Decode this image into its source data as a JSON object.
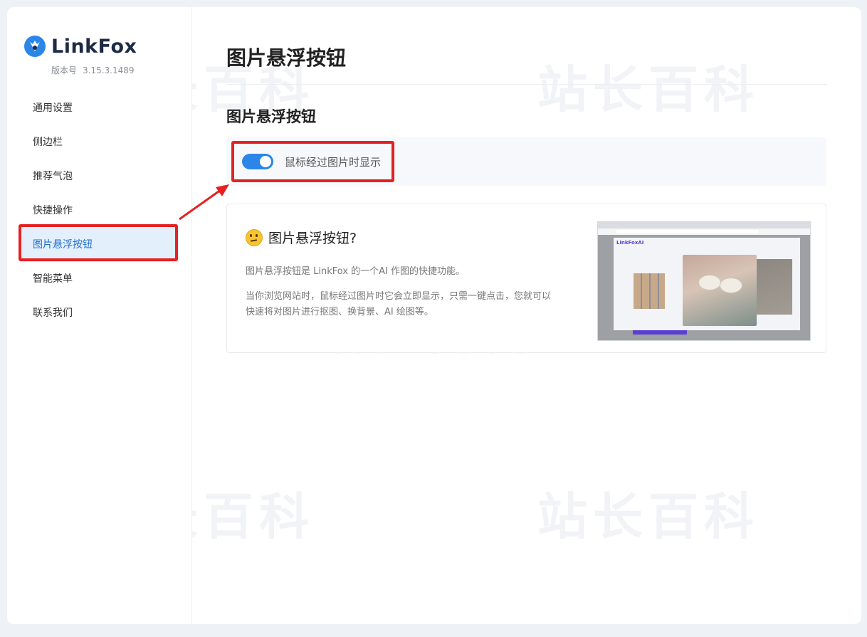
{
  "app": {
    "brand": "LinkFox",
    "version_label": "版本号",
    "version_value": "3.15.3.1489"
  },
  "sidebar": {
    "items": [
      {
        "label": "通用设置"
      },
      {
        "label": "侧边栏"
      },
      {
        "label": "推荐气泡"
      },
      {
        "label": "快捷操作"
      },
      {
        "label": "图片悬浮按钮",
        "active": true
      },
      {
        "label": "智能菜单"
      },
      {
        "label": "联系我们"
      }
    ]
  },
  "main": {
    "page_title": "图片悬浮按钮",
    "section_title": "图片悬浮按钮",
    "setting": {
      "label": "鼠标经过图片时显示",
      "enabled": true
    },
    "info": {
      "title": "图片悬浮按钮?",
      "desc1": "图片悬浮按钮是 LinkFox 的一个AI 作图的快捷功能。",
      "desc2": "当你浏览网站时，鼠标经过图片时它会立即显示，只需一键点击，您就可以快速将对图片进行抠图、换背景、AI 绘图等。",
      "preview_brand": "LinkFoxAI"
    }
  },
  "watermark": "站长百科",
  "colors": {
    "accent": "#2b86e8",
    "active_bg": "#e3effb",
    "highlight": "#e52121"
  }
}
